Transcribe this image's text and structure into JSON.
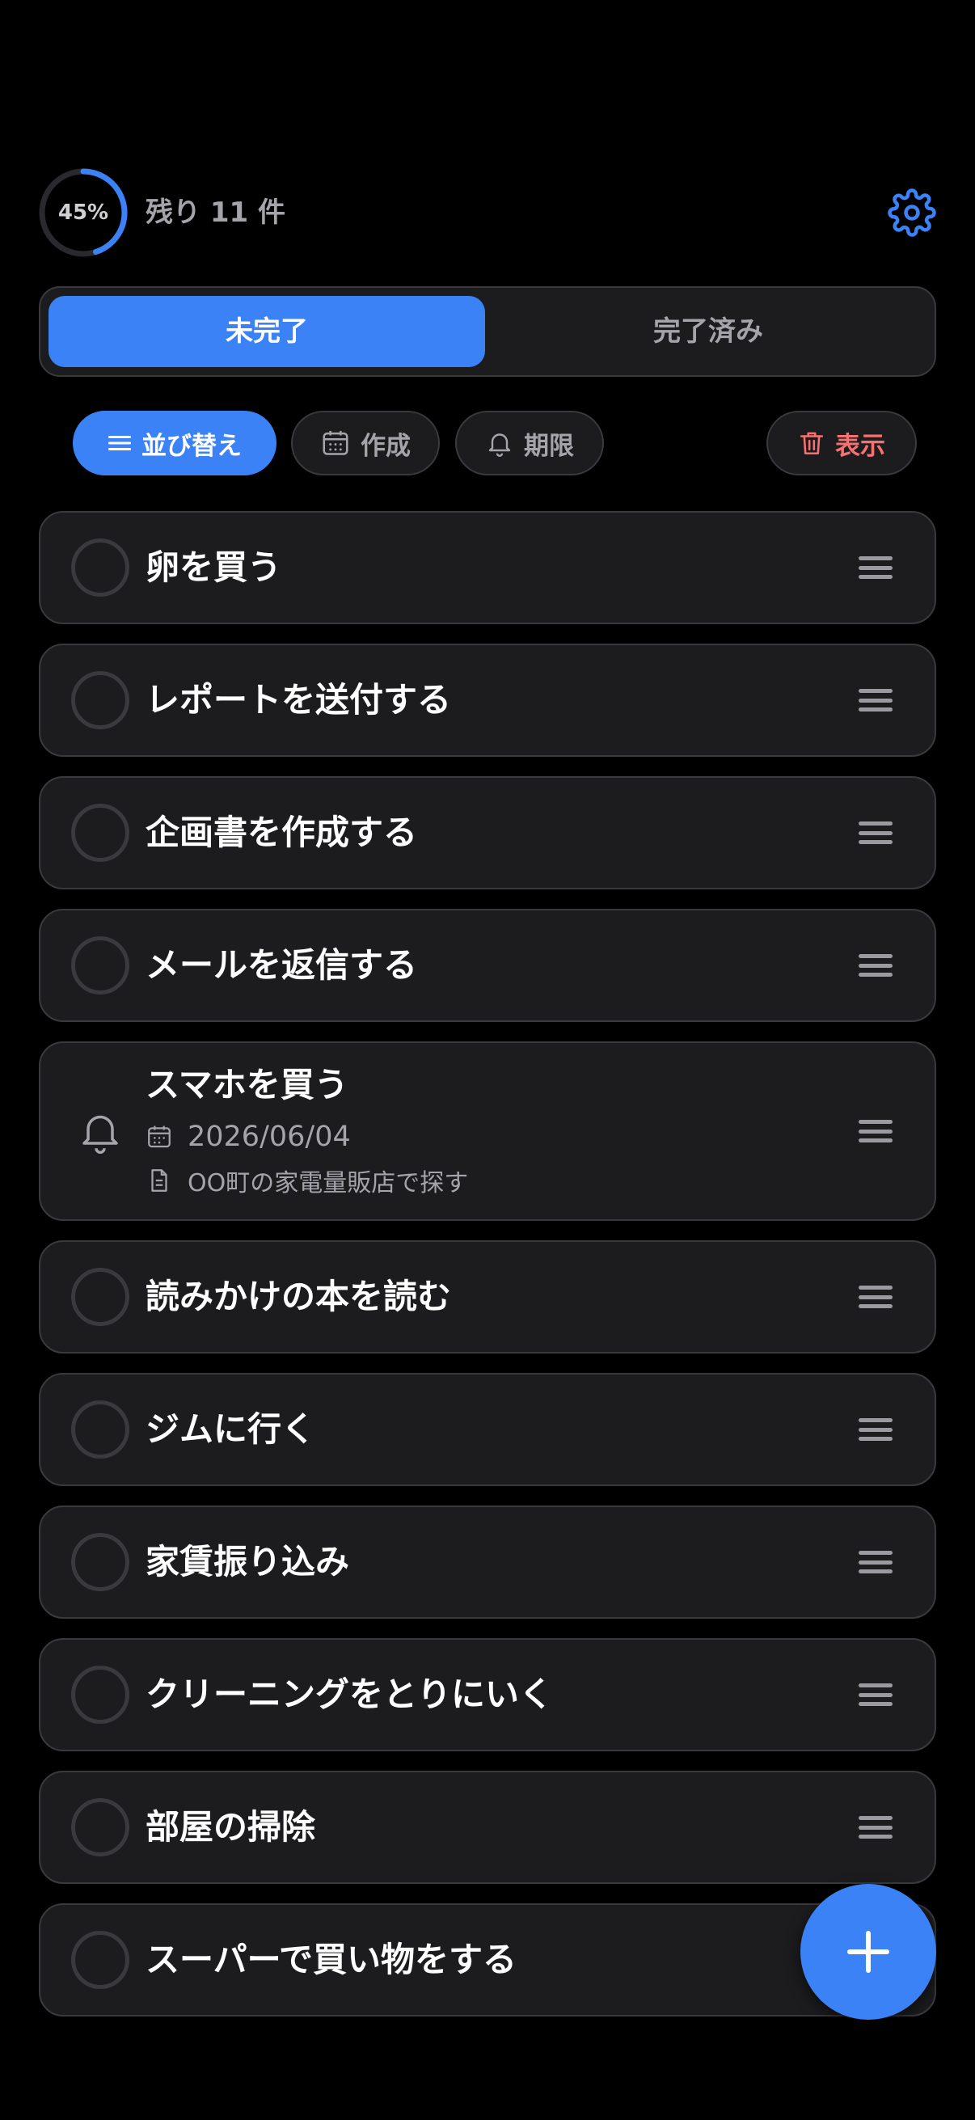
{
  "header": {
    "progress": 45,
    "progress_label": "45%",
    "remaining": "残り 11 件"
  },
  "tabs": {
    "active": "未完了",
    "inactive": "完了済み"
  },
  "filters": {
    "sort": "並び替え",
    "created": "作成",
    "due": "期限",
    "display": "表示"
  },
  "tasks": [
    {
      "title": "卵を買う"
    },
    {
      "title": "レポートを送付する"
    },
    {
      "title": "企画書を作成する"
    },
    {
      "title": "メールを返信する"
    },
    {
      "title": "スマホを買う",
      "date": "2026/06/04",
      "note": "OO町の家電量販店で探す"
    },
    {
      "title": "読みかけの本を読む"
    },
    {
      "title": "ジムに行く"
    },
    {
      "title": "家賃振り込み"
    },
    {
      "title": "クリーニングをとりにいく"
    },
    {
      "title": "部屋の掃除"
    },
    {
      "title": "スーパーで買い物をする"
    }
  ],
  "colors": {
    "accent": "#3b82f6",
    "danger": "#f87171",
    "card": "#1c1c1e",
    "border": "#3a3a3e",
    "background": "#000000"
  },
  "icons": {
    "settings": "gear-icon",
    "sort": "list-icon",
    "created": "calendar-icon",
    "due": "bell-icon",
    "display": "trash-icon",
    "handle": "drag-handle-icon",
    "add": "plus-icon"
  }
}
